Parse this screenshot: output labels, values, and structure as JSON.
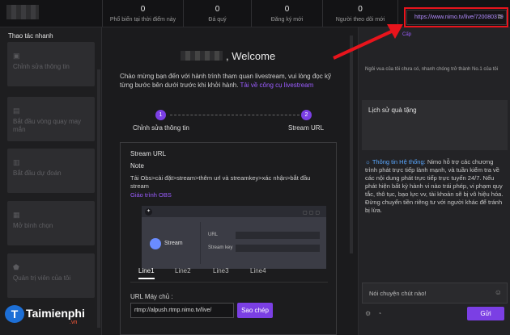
{
  "topbar": {
    "stats": [
      {
        "value": "0",
        "label": "Phổ biến tại thời điểm này"
      },
      {
        "value": "0",
        "label": "Đá quý"
      },
      {
        "value": "0",
        "label": "Đăng ký mới"
      },
      {
        "value": "0",
        "label": "Người theo dõi mới"
      }
    ],
    "room_url": "https://www.nimo.tv/live/720080379"
  },
  "sidebar": {
    "title": "Thao tác nhanh",
    "items": [
      {
        "label": "Chỉnh sửa thông tin",
        "icon": "camera-icon"
      },
      {
        "label": "Bắt đầu vòng quay may mắn",
        "icon": "gift-icon"
      },
      {
        "label": "Bắt đầu dự đoán",
        "icon": "prediction-icon"
      },
      {
        "label": "Mở bình chọn",
        "icon": "poll-icon"
      },
      {
        "label": "Quản trị viên của tôi",
        "icon": "shield-icon"
      }
    ]
  },
  "main": {
    "welcome": "Welcome",
    "intro_text": "Chào mừng bạn đến với hành trình tham quan livestream, vui lòng đọc kỹ từng bước bên dưới trước khi khởi hành.",
    "intro_link": "Tải về công cụ livestream",
    "steps": [
      {
        "num": "1",
        "label": "Chỉnh sửa thông tin"
      },
      {
        "num": "2",
        "label": "Stream URL"
      }
    ],
    "panel": {
      "title": "Stream URL",
      "note_title": "Note",
      "note_text": "Tải Obs>cài đặt>stream>thêm url và streamkey>xác nhận>bắt đầu stream",
      "guide_link": "Giáo trình OBS",
      "obs_stream": "Stream",
      "obs_url": "URL",
      "obs_key": "Stream key",
      "tabs": [
        "Line1",
        "Line2",
        "Line3",
        "Line4"
      ],
      "url_label": "URL Máy chủ :",
      "url_value": "rtmp://alpush.rtmp.nimo.tv/live/",
      "copy_label": "Sao chép"
    }
  },
  "chat": {
    "tab_label": "Cấp",
    "promo": "Ngôi vua của tôi chưa có, nhanh chóng trở thành No.1 của tôi",
    "gift_title": "Lịch sử quà tặng",
    "system_label": "Thông tin Hệ thống:",
    "system_text": "Nimo hỗ trợ các chương trình phát trực tiếp lành mạnh, và tuần kiểm tra về các nội dung phát trực tiếp trực tuyến 24/7. Nếu phát hiện bất kỳ hành vi nào trái phép, vi phạm quy tắc, thô tục, bạo lực vv, tài khoản sẽ bị vô hiệu hóa. Đừng chuyển tiền riêng tư với người khác để tránh bị lừa.",
    "input_placeholder": "Nói chuyện chút nào!",
    "send_label": "Gửi"
  },
  "watermark": {
    "brand": "Taimienphi",
    "tld": ".vn"
  },
  "colors": {
    "accent": "#7b3fe4",
    "link": "#9b5cff",
    "arrow": "#e8141c"
  }
}
